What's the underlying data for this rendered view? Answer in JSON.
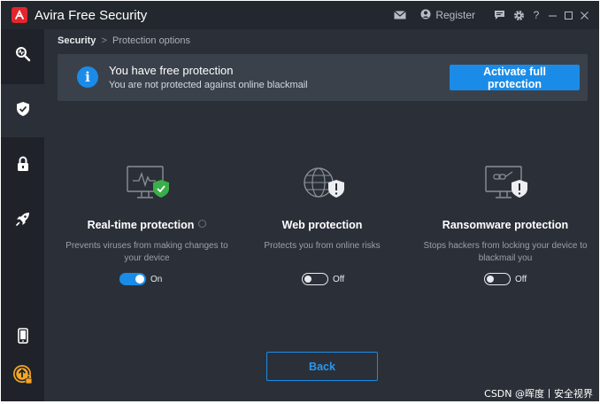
{
  "app": {
    "title": "Free Security",
    "brand": "Avira",
    "register_label": "Register",
    "help_label": "?"
  },
  "breadcrumb": {
    "root": "Security",
    "separator": ">",
    "current": "Protection options"
  },
  "banner": {
    "title": "You have free protection",
    "subtitle": "You are not protected against online blackmail",
    "cta_label": "Activate full protection"
  },
  "features": [
    {
      "title": "Real-time protection",
      "description": "Prevents viruses from making changes to your device",
      "toggle_state": "On",
      "enabled": true
    },
    {
      "title": "Web protection",
      "description": "Protects you from online risks",
      "toggle_state": "Off",
      "enabled": false
    },
    {
      "title": "Ransomware protection",
      "description": "Stops hackers from locking your device to blackmail you",
      "toggle_state": "Off",
      "enabled": false
    }
  ],
  "back_label": "Back",
  "watermark": "CSDN @晖度丨安全视界",
  "colors": {
    "accent": "#1a8ce8",
    "brand_red": "#e4252c",
    "success_green": "#3aae49",
    "background": "#2b3038",
    "sidebar": "#1f2329"
  },
  "sidebar": {
    "items": [
      {
        "icon": "scan-icon"
      },
      {
        "icon": "shield-icon",
        "active": true
      },
      {
        "icon": "lock-icon"
      },
      {
        "icon": "rocket-icon"
      },
      {
        "icon": "mobile-icon"
      },
      {
        "icon": "upgrade-icon"
      }
    ]
  }
}
